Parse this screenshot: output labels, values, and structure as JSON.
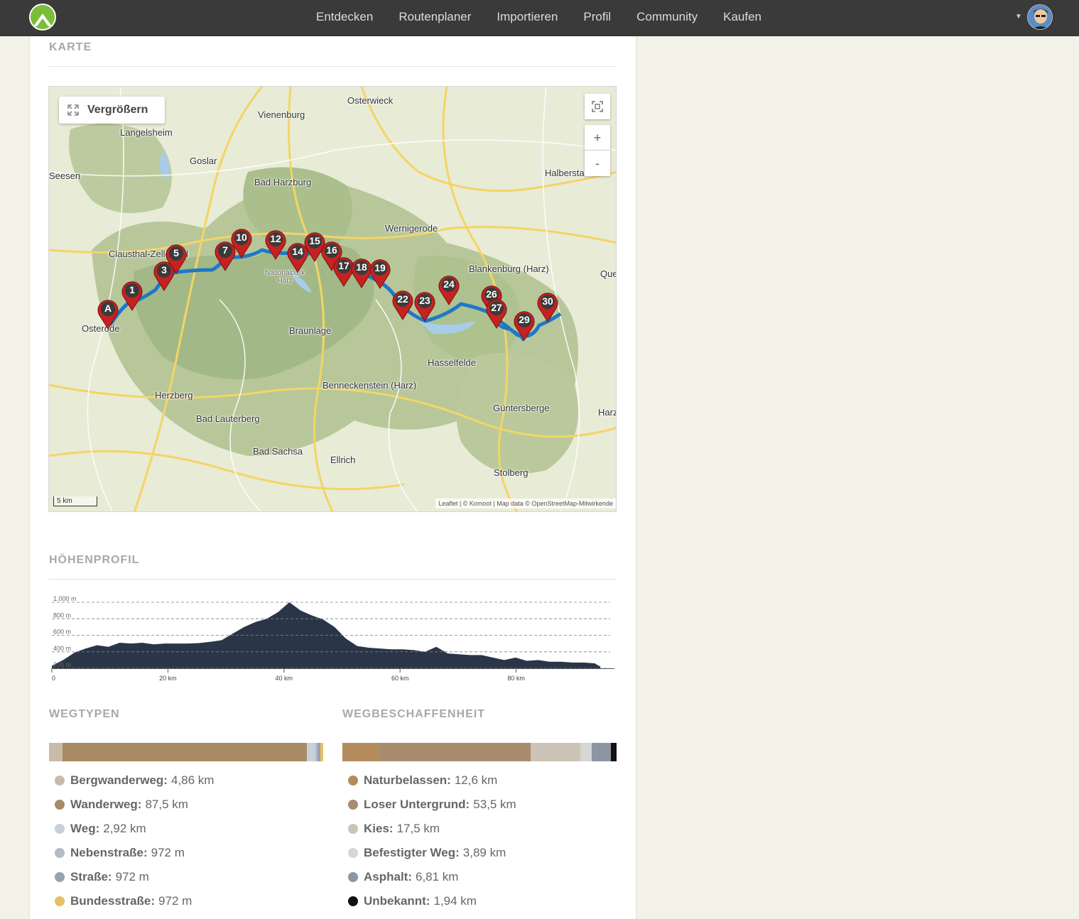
{
  "nav": {
    "items": [
      "Entdecken",
      "Routenplaner",
      "Importieren",
      "Profil",
      "Community",
      "Kaufen"
    ]
  },
  "sections": {
    "map_title": "KARTE",
    "elevation_title": "HÖHENPROFIL",
    "waytypes_title": "WEGTYPEN",
    "surfaces_title": "WEGBESCHAFFENHEIT"
  },
  "map": {
    "enlarge_label": "Vergrößern",
    "zoom_in": "+",
    "zoom_out": "-",
    "scale_label": "5 km",
    "attribution": "Leaflet | © Komoot | Map data © OpenStreetMap-Mitwirkende",
    "places": [
      "Osterwieck",
      "Vienenburg",
      "Langelsheim",
      "Goslar",
      "Halberstadt",
      "Seesen",
      "Bad Harzburg",
      "Wernigerode",
      "Clausthal-Zellerfeld",
      "Blankenburg (Harz)",
      "Quedlinburg",
      "Nationalpark Harz",
      "Osterode",
      "Braunlage",
      "Hasselfelde",
      "Benneckenstein (Harz)",
      "Herzberg",
      "Güntersberge",
      "Harzgerode",
      "Bad Lauterberg",
      "Bad Sachsa",
      "Ellrich",
      "Stolberg"
    ],
    "start_marker": "A",
    "waypoints": [
      "1",
      "3",
      "5",
      "7",
      "10",
      "12",
      "14",
      "15",
      "16",
      "17",
      "18",
      "19",
      "22",
      "23",
      "24",
      "26",
      "27",
      "29",
      "30"
    ]
  },
  "elevation": {
    "y_ticks": [
      "1.000 m",
      "800 m",
      "600 m",
      "400 m",
      "200 m"
    ],
    "x_ticks": [
      "0",
      "20 km",
      "40 km",
      "60 km",
      "80 km"
    ]
  },
  "waytypes": {
    "colors": [
      "#c8bca9",
      "#a88b64",
      "#c9d0d8",
      "#b4bcc6",
      "#98a2b0",
      "#e8c060"
    ],
    "items": [
      {
        "name": "Bergwanderweg:",
        "value": "4,86 km",
        "km": 4.86
      },
      {
        "name": "Wanderweg:",
        "value": "87,5 km",
        "km": 87.5
      },
      {
        "name": "Weg:",
        "value": "2,92 km",
        "km": 2.92
      },
      {
        "name": "Nebenstraße:",
        "value": "972 m",
        "km": 0.972
      },
      {
        "name": "Straße:",
        "value": "972 m",
        "km": 0.972
      },
      {
        "name": "Bundesstraße:",
        "value": "972 m",
        "km": 0.972
      }
    ]
  },
  "surfaces": {
    "colors": [
      "#b48c5c",
      "#a88c70",
      "#ccc4b6",
      "#d6d6d6",
      "#8c96a2",
      "#111111"
    ],
    "items": [
      {
        "name": "Naturbelassen:",
        "value": "12,6 km",
        "km": 12.6
      },
      {
        "name": "Loser Untergrund:",
        "value": "53,5 km",
        "km": 53.5
      },
      {
        "name": "Kies:",
        "value": "17,5 km",
        "km": 17.5
      },
      {
        "name": "Befestigter Weg:",
        "value": "3,89 km",
        "km": 3.89
      },
      {
        "name": "Asphalt:",
        "value": "6,81 km",
        "km": 6.81
      },
      {
        "name": "Unbekannt:",
        "value": "1,94 km",
        "km": 1.94
      }
    ]
  },
  "chart_data": {
    "type": "area",
    "title": "",
    "xlabel": "",
    "ylabel": "",
    "xlim": [
      0,
      100
    ],
    "ylim": [
      200,
      1000
    ],
    "x_ticks": [
      "0",
      "20 km",
      "40 km",
      "60 km",
      "80 km"
    ],
    "y_ticks": [
      "200 m",
      "400 m",
      "600 m",
      "800 m",
      "1.000 m"
    ],
    "grid": true,
    "series": [
      {
        "x": [
          0,
          2,
          4,
          6,
          8,
          10,
          12,
          14,
          16,
          18,
          20,
          22,
          24,
          26,
          28,
          30,
          32,
          34,
          36,
          38,
          40,
          42,
          44,
          46,
          48,
          50,
          52,
          54,
          56,
          58,
          60,
          62,
          64,
          66,
          68,
          70,
          72,
          74,
          76,
          78,
          80,
          82,
          84,
          86,
          88,
          90,
          92,
          94,
          96,
          97
        ],
        "y": [
          230,
          300,
          390,
          440,
          480,
          460,
          510,
          500,
          510,
          490,
          500,
          500,
          500,
          505,
          520,
          540,
          620,
          700,
          760,
          800,
          880,
          1000,
          900,
          840,
          790,
          700,
          560,
          470,
          450,
          440,
          430,
          430,
          420,
          400,
          460,
          380,
          370,
          360,
          360,
          330,
          300,
          330,
          290,
          300,
          280,
          280,
          270,
          270,
          260,
          220
        ]
      }
    ]
  }
}
